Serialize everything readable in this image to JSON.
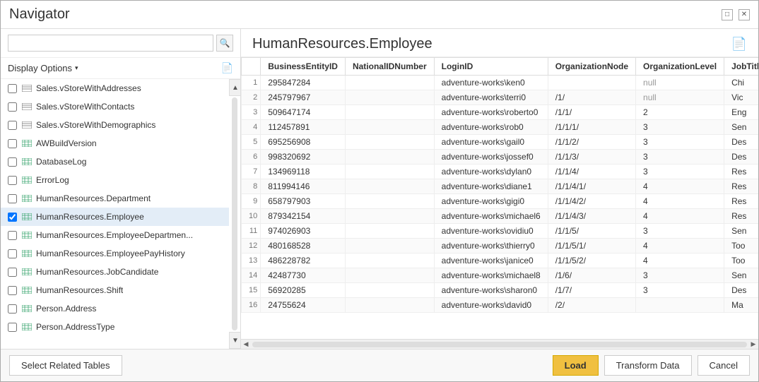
{
  "window": {
    "title": "Navigator",
    "minimize_label": "🗗",
    "close_label": "✕"
  },
  "sidebar": {
    "search_placeholder": "",
    "display_options_label": "Display Options",
    "chevron": "▾",
    "items": [
      {
        "id": "SalesStoreWithAddresses",
        "label": "Sales.vStoreWithAddresses",
        "type": "view",
        "checked": false,
        "partial": true
      },
      {
        "id": "SalesStoreWithContacts",
        "label": "Sales.vStoreWithContacts",
        "type": "view",
        "checked": false
      },
      {
        "id": "SalesStoreWithDemographics",
        "label": "Sales.vStoreWithDemographics",
        "type": "view",
        "checked": false
      },
      {
        "id": "AWBuildVersion",
        "label": "AWBuildVersion",
        "type": "table",
        "checked": false
      },
      {
        "id": "DatabaseLog",
        "label": "DatabaseLog",
        "type": "table",
        "checked": false
      },
      {
        "id": "ErrorLog",
        "label": "ErrorLog",
        "type": "table",
        "checked": false
      },
      {
        "id": "HumanResourcesDepartment",
        "label": "HumanResources.Department",
        "type": "table",
        "checked": false
      },
      {
        "id": "HumanResourcesEmployee",
        "label": "HumanResources.Employee",
        "type": "table",
        "checked": true,
        "selected": true
      },
      {
        "id": "HumanResourcesEmployeeDepartmen",
        "label": "HumanResources.EmployeeDepartmen...",
        "type": "table",
        "checked": false
      },
      {
        "id": "HumanResourcesEmployeePayHistory",
        "label": "HumanResources.EmployeePayHistory",
        "type": "table",
        "checked": false
      },
      {
        "id": "HumanResourcesJobCandidate",
        "label": "HumanResources.JobCandidate",
        "type": "table",
        "checked": false
      },
      {
        "id": "HumanResourcesShift",
        "label": "HumanResources.Shift",
        "type": "table",
        "checked": false
      },
      {
        "id": "PersonAddress",
        "label": "Person.Address",
        "type": "table",
        "checked": false
      },
      {
        "id": "PersonAddressType",
        "label": "Person.AddressType",
        "type": "table",
        "checked": false
      }
    ]
  },
  "main": {
    "title": "HumanResources.Employee",
    "columns": [
      "BusinessEntityID",
      "NationalIDNumber",
      "LoginID",
      "OrganizationNode",
      "OrganizationLevel",
      "JobTitl"
    ],
    "rows": [
      {
        "num": 1,
        "BusinessEntityID": 295847284,
        "NationalIDNumber": "",
        "LoginID": "adventure-works\\ken0",
        "OrganizationNode": "",
        "OrganizationLevel": "null",
        "JobTitle": "Chi"
      },
      {
        "num": 2,
        "BusinessEntityID": 245797967,
        "NationalIDNumber": "",
        "LoginID": "adventure-works\\terri0",
        "OrganizationNode": "/1/",
        "OrganizationLevel": "null",
        "JobTitle": "Vic"
      },
      {
        "num": 3,
        "BusinessEntityID": 509647174,
        "NationalIDNumber": "",
        "LoginID": "adventure-works\\roberto0",
        "OrganizationNode": "/1/1/",
        "OrganizationLevel": 2,
        "JobTitle": "Eng"
      },
      {
        "num": 4,
        "BusinessEntityID": 112457891,
        "NationalIDNumber": "",
        "LoginID": "adventure-works\\rob0",
        "OrganizationNode": "/1/1/1/",
        "OrganizationLevel": 3,
        "JobTitle": "Sen"
      },
      {
        "num": 5,
        "BusinessEntityID": 695256908,
        "NationalIDNumber": "",
        "LoginID": "adventure-works\\gail0",
        "OrganizationNode": "/1/1/2/",
        "OrganizationLevel": 3,
        "JobTitle": "Des"
      },
      {
        "num": 6,
        "BusinessEntityID": 998320692,
        "NationalIDNumber": "",
        "LoginID": "adventure-works\\jossef0",
        "OrganizationNode": "/1/1/3/",
        "OrganizationLevel": 3,
        "JobTitle": "Des"
      },
      {
        "num": 7,
        "BusinessEntityID": 134969118,
        "NationalIDNumber": "",
        "LoginID": "adventure-works\\dylan0",
        "OrganizationNode": "/1/1/4/",
        "OrganizationLevel": 3,
        "JobTitle": "Res"
      },
      {
        "num": 8,
        "BusinessEntityID": 811994146,
        "NationalIDNumber": "",
        "LoginID": "adventure-works\\diane1",
        "OrganizationNode": "/1/1/4/1/",
        "OrganizationLevel": 4,
        "JobTitle": "Res"
      },
      {
        "num": 9,
        "BusinessEntityID": 658797903,
        "NationalIDNumber": "",
        "LoginID": "adventure-works\\gigi0",
        "OrganizationNode": "/1/1/4/2/",
        "OrganizationLevel": 4,
        "JobTitle": "Res"
      },
      {
        "num": 10,
        "BusinessEntityID": 879342154,
        "NationalIDNumber": "",
        "LoginID": "adventure-works\\michael6",
        "OrganizationNode": "/1/1/4/3/",
        "OrganizationLevel": 4,
        "JobTitle": "Res"
      },
      {
        "num": 11,
        "BusinessEntityID": 974026903,
        "NationalIDNumber": "",
        "LoginID": "adventure-works\\ovidiu0",
        "OrganizationNode": "/1/1/5/",
        "OrganizationLevel": 3,
        "JobTitle": "Sen"
      },
      {
        "num": 12,
        "BusinessEntityID": 480168528,
        "NationalIDNumber": "",
        "LoginID": "adventure-works\\thierry0",
        "OrganizationNode": "/1/1/5/1/",
        "OrganizationLevel": 4,
        "JobTitle": "Too"
      },
      {
        "num": 13,
        "BusinessEntityID": 486228782,
        "NationalIDNumber": "",
        "LoginID": "adventure-works\\janice0",
        "OrganizationNode": "/1/1/5/2/",
        "OrganizationLevel": 4,
        "JobTitle": "Too"
      },
      {
        "num": 14,
        "BusinessEntityID": 42487730,
        "NationalIDNumber": "",
        "LoginID": "adventure-works\\michael8",
        "OrganizationNode": "/1/6/",
        "OrganizationLevel": 3,
        "JobTitle": "Sen"
      },
      {
        "num": 15,
        "BusinessEntityID": 56920285,
        "NationalIDNumber": "",
        "LoginID": "adventure-works\\sharon0",
        "OrganizationNode": "/1/7/",
        "OrganizationLevel": 3,
        "JobTitle": "Des"
      },
      {
        "num": 16,
        "BusinessEntityID": 24755624,
        "NationalIDNumber": "",
        "LoginID": "adventure-works\\david0",
        "OrganizationNode": "/2/",
        "OrganizationLevel": "",
        "JobTitle": "Ma"
      }
    ]
  },
  "footer": {
    "select_related_tables": "Select Related Tables",
    "load_label": "Load",
    "transform_data_label": "Transform Data",
    "cancel_label": "Cancel"
  }
}
